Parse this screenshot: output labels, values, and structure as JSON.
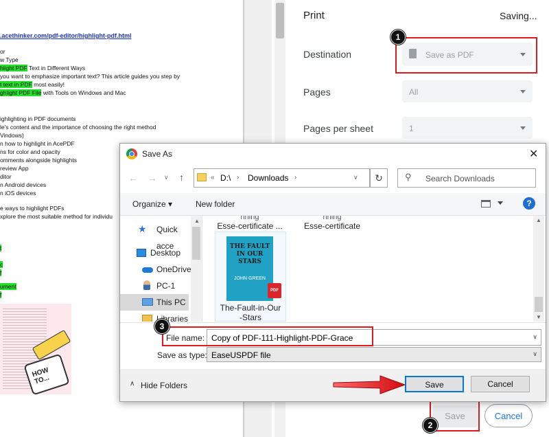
{
  "document": {
    "url": ".acethinker.com/pdf-editor/highlight-pdf.html",
    "lines": [
      {
        "pre": "or",
        "hl": "",
        "post": ""
      },
      {
        "pre": "w Type",
        "hl": "",
        "post": ""
      },
      {
        "pre": "",
        "hl": "hlight PDF",
        "post": " Text in Different Ways"
      },
      {
        "pre": "you want to emphasize important text? This article guides you step by",
        "hl": "",
        "post": ""
      },
      {
        "pre": "",
        "hl": "t text in PDF",
        "post": " most easily!"
      },
      {
        "pre": "",
        "hl": "ghlight PDF File",
        "post": " with Tools on Windows and Mac"
      },
      {
        "pre": "ighlighting in PDF documents",
        "hl": "",
        "post": ""
      },
      {
        "pre": "le's content and the importance of choosing the right method",
        "hl": "",
        "post": ""
      },
      {
        "pre": "Vindows)",
        "hl": "",
        "post": ""
      },
      {
        "pre": "n how to highlight in AcePDF",
        "hl": "",
        "post": ""
      },
      {
        "pre": "ns for color and opacity",
        "hl": "",
        "post": ""
      },
      {
        "pre": "omments alongside highlights",
        "hl": "",
        "post": ""
      },
      {
        "pre": "review App",
        "hl": "",
        "post": ""
      },
      {
        "pre": "ditor",
        "hl": "",
        "post": ""
      },
      {
        "pre": "n Android devices",
        "hl": "",
        "post": ""
      },
      {
        "pre": "n iOS devices",
        "hl": "",
        "post": ""
      },
      {
        "pre": "e ways to highlight PDFs",
        "hl": "",
        "post": ""
      },
      {
        "pre": "xplore the most suitable method for individu",
        "hl": "",
        "post": ""
      },
      {
        "pre": "",
        "hl": "t",
        "post": ""
      },
      {
        "pre": "",
        "hl": "c",
        "post": ""
      },
      {
        "pre": "",
        "hl": "f",
        "post": ""
      },
      {
        "pre": "",
        "hl": "ument",
        "post": ""
      },
      {
        "pre": "",
        "hl": "f",
        "post": ""
      }
    ],
    "thumb_text": "HOW TO..."
  },
  "print": {
    "title": "Print",
    "status": "Saving...",
    "destination_label": "Destination",
    "destination_value": "Save as PDF",
    "pages_label": "Pages",
    "pages_value": "All",
    "pps_label": "Pages per sheet",
    "pps_value": "1",
    "save_label": "Save",
    "cancel_label": "Cancel"
  },
  "dialog": {
    "title": "Save As",
    "path": [
      "«",
      "D:\\",
      "›",
      "Downloads",
      "›"
    ],
    "search_placeholder": "Search Downloads",
    "organize_label": "Organize ▾",
    "new_folder_label": "New folder",
    "help_label": "?",
    "nav_items": [
      "Quick acce",
      "Desktop",
      "OneDrive",
      "PC-1",
      "This PC",
      "Libraries"
    ],
    "files": [
      {
        "top": "nning",
        "name": "Esse-certificate ..."
      },
      {
        "top": "nning",
        "name": "Esse-certificate"
      }
    ],
    "book": {
      "title_lines": [
        "THE FAULT",
        "IN OUR STARS"
      ],
      "author": "JOHN GREEN",
      "badge": "PDF",
      "file_name_lines": [
        "The-Fault-in-Our",
        "-Stars"
      ]
    },
    "file_name_label": "File name:",
    "file_name_value": "Copy of PDF-111-Highlight-PDF-Grace",
    "save_type_label": "Save as type:",
    "save_type_value": "EaseUSPDF file",
    "hide_folders_label": "Hide Folders",
    "save_label": "Save",
    "cancel_label": "Cancel"
  },
  "markers": [
    "1",
    "2",
    "3"
  ],
  "colors": {
    "accent_red": "#e0191c",
    "highlight": "#22e02a",
    "link": "#1a33c8",
    "chrome_blue": "#1a73e8"
  }
}
